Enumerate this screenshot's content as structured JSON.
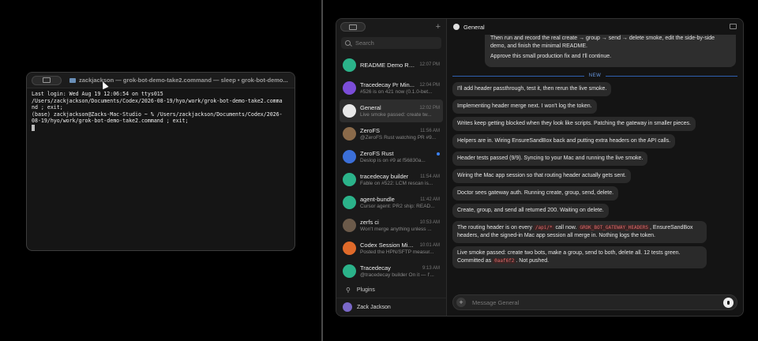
{
  "terminal": {
    "title": "zackjackson — grok-bot-demo-take2.command — sleep • grok-bot-demo...",
    "lines": "Last login: Wed Aug 19 12:06:54 on ttys015\n/Users/zackjackson/Documents/Codex/2026-08-19/hyo/work/grok-bot-demo-take2.comma\nnd ; exit;\n(base) zackjackson@Zacks-Mac-Studio ~ % /Users/zackjackson/Documents/Codex/2026-\n08-19/hyo/work/grok-bot-demo-take2.command ; exit;"
  },
  "sidebar": {
    "search_placeholder": "Search",
    "conversations": [
      {
        "name": "README Demo Re...",
        "time": "12:07 PM",
        "preview": "",
        "color": "#2bb38a",
        "active": false,
        "unread": false
      },
      {
        "name": "Tracedecay Pr Min...",
        "time": "12:04 PM",
        "preview": "#526 is on 421 now (0.1.0-bet...",
        "color": "#7b4dd8",
        "active": false,
        "unread": false
      },
      {
        "name": "General",
        "time": "12:02 PM",
        "preview": "Live smoke passed: create tw...",
        "color": "#e8e8e8",
        "active": true,
        "unread": false
      },
      {
        "name": "ZeroFS",
        "time": "11:56 AM",
        "preview": "@ZeroFS Rust watching PR #9...",
        "color": "#8a6a4a",
        "active": false,
        "unread": false
      },
      {
        "name": "ZeroFS Rust",
        "time": "",
        "preview": "Deslop is on #9 at f56830a...",
        "color": "#3b6fd8",
        "active": false,
        "unread": true
      },
      {
        "name": "tracedecay builder",
        "time": "11:54 AM",
        "preview": "Fable on #522: LCM rescan is...",
        "color": "#2bb38a",
        "active": false,
        "unread": false
      },
      {
        "name": "agent-bundle",
        "time": "11:42 AM",
        "preview": "Cursor agent: PR2 ship: READ...",
        "color": "#2bb38a",
        "active": false,
        "unread": false
      },
      {
        "name": "zerfs ci",
        "time": "10:53 AM",
        "preview": "Won't merge anything unless ...",
        "color": "#6b5a4a",
        "active": false,
        "unread": false
      },
      {
        "name": "Codex Session Min...",
        "time": "10:01 AM",
        "preview": "Posted the HPN/SFTP measur...",
        "color": "#e06a2a",
        "active": false,
        "unread": false
      },
      {
        "name": "Tracedecay",
        "time": "9:13 AM",
        "preview": "@tracedecay builder On it — I'...",
        "color": "#2bb38a",
        "active": false,
        "unread": false
      }
    ],
    "plugins_label": "Plugins",
    "user_name": "Zack Jackson"
  },
  "main": {
    "channel": "General",
    "user_msg": [
      "Then run and record the real create → group → send → delete smoke, edit the side-by-side demo, and finish the minimal README.",
      "Approve this small production fix and I'll continue."
    ],
    "new_label": "NEW",
    "bot_msgs": [
      "I'll add header passthrough, test it, then rerun the live smoke.",
      "Implementing header merge next. I won't log the token.",
      "Writes keep getting blocked when they look like scripts. Patching the gateway in smaller pieces.",
      "Helpers are in. Wiring EnsureSandBox back and putting extra headers on the API calls.",
      "Header tests passed (9/9). Syncing to your Mac and running the live smoke.",
      "Wiring the Mac app session so that routing header actually gets sent.",
      "Doctor sees gateway auth. Running create, group, send, delete.",
      "Create, group, and send all returned 200. Waiting on delete."
    ],
    "routing": {
      "t1": "The routing header is on every ",
      "c1": "/api/*",
      "t2": " call now. ",
      "c2": "GROK_BOT_GATEWAY_HEADERS",
      "t3": ", EnsureSandBox headers, and the signed-in Mac app session all merge in. Nothing logs the token."
    },
    "final": {
      "t1": "Live smoke passed: create two bots, make a group, send to both, delete all. 12 tests green. Committed as ",
      "c1": "0aaf6f2",
      "t2": ". Not pushed."
    },
    "composer_placeholder": "Message General"
  }
}
